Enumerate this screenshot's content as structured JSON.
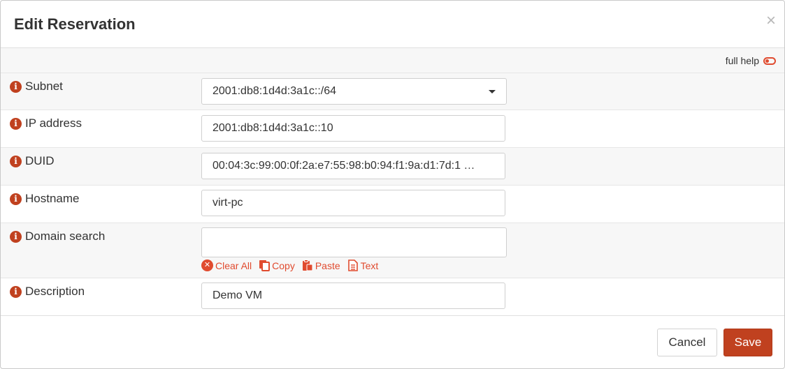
{
  "dialog": {
    "title": "Edit Reservation",
    "close_symbol": "×"
  },
  "help": {
    "full_help_label": "full help",
    "toggle_state": "off"
  },
  "fields": {
    "subnet": {
      "label": "Subnet",
      "value": "2001:db8:1d4d:3a1c::/64"
    },
    "ip_address": {
      "label": "IP address",
      "value": "2001:db8:1d4d:3a1c::10"
    },
    "duid": {
      "label": "DUID",
      "value": "00:04:3c:99:00:0f:2a:e7:55:98:b0:94:f1:9a:d1:7d:1 …"
    },
    "hostname": {
      "label": "Hostname",
      "value": "virt-pc"
    },
    "domain_search": {
      "label": "Domain search",
      "value": ""
    },
    "description": {
      "label": "Description",
      "value": "Demo VM"
    }
  },
  "token_actions": {
    "clear_all": "Clear All",
    "copy": "Copy",
    "paste": "Paste",
    "text": "Text"
  },
  "footer": {
    "cancel_label": "Cancel",
    "save_label": "Save"
  },
  "colors": {
    "accent": "#e04b2f",
    "primary_button": "#c0411f",
    "info_icon": "#c0411f"
  }
}
